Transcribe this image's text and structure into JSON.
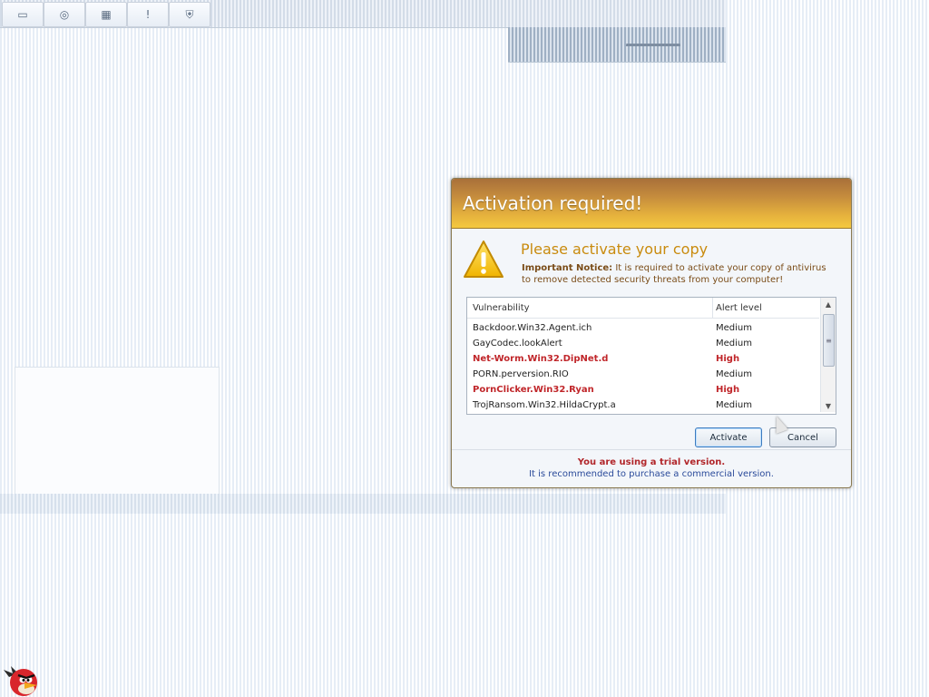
{
  "toolbar": {
    "buttons": [
      {
        "name": "folder-button",
        "glyph": "▭"
      },
      {
        "name": "browser-button",
        "glyph": "◎"
      },
      {
        "name": "calendar-button",
        "glyph": "▦"
      },
      {
        "name": "alert-button",
        "glyph": "!"
      },
      {
        "name": "shield-button",
        "glyph": "⛨"
      }
    ]
  },
  "dialog": {
    "title": "Activation required!",
    "heading": "Please activate your copy",
    "notice_label": "Important Notice:",
    "notice_text": "It is required to activate your copy of antivirus to remove detected security threats from your computer!",
    "table": {
      "headers": {
        "vulnerability": "Vulnerability",
        "alert_level": "Alert level"
      },
      "rows": [
        {
          "name": "Backdoor.Win32.Agent.ich",
          "level": "Medium",
          "high": false
        },
        {
          "name": "GayCodec.lookAlert",
          "level": "Medium",
          "high": false
        },
        {
          "name": "Net-Worm.Win32.DipNet.d",
          "level": "High",
          "high": true
        },
        {
          "name": "PORN.perversion.RIO",
          "level": "Medium",
          "high": false
        },
        {
          "name": "PornClicker.Win32.Ryan",
          "level": "High",
          "high": true
        },
        {
          "name": "TrojRansom.Win32.HildaCrypt.a",
          "level": "Medium",
          "high": false
        }
      ]
    },
    "buttons": {
      "activate": "Activate",
      "cancel": "Cancel"
    },
    "footer": {
      "trial": "You are using a trial version.",
      "recommend": "It is recommended to purchase a commercial version."
    }
  },
  "colors": {
    "title_gradient_start": "#a9703a",
    "title_gradient_end": "#f4c93f",
    "high_alert": "#c0262a",
    "heading": "#c98b0e"
  }
}
